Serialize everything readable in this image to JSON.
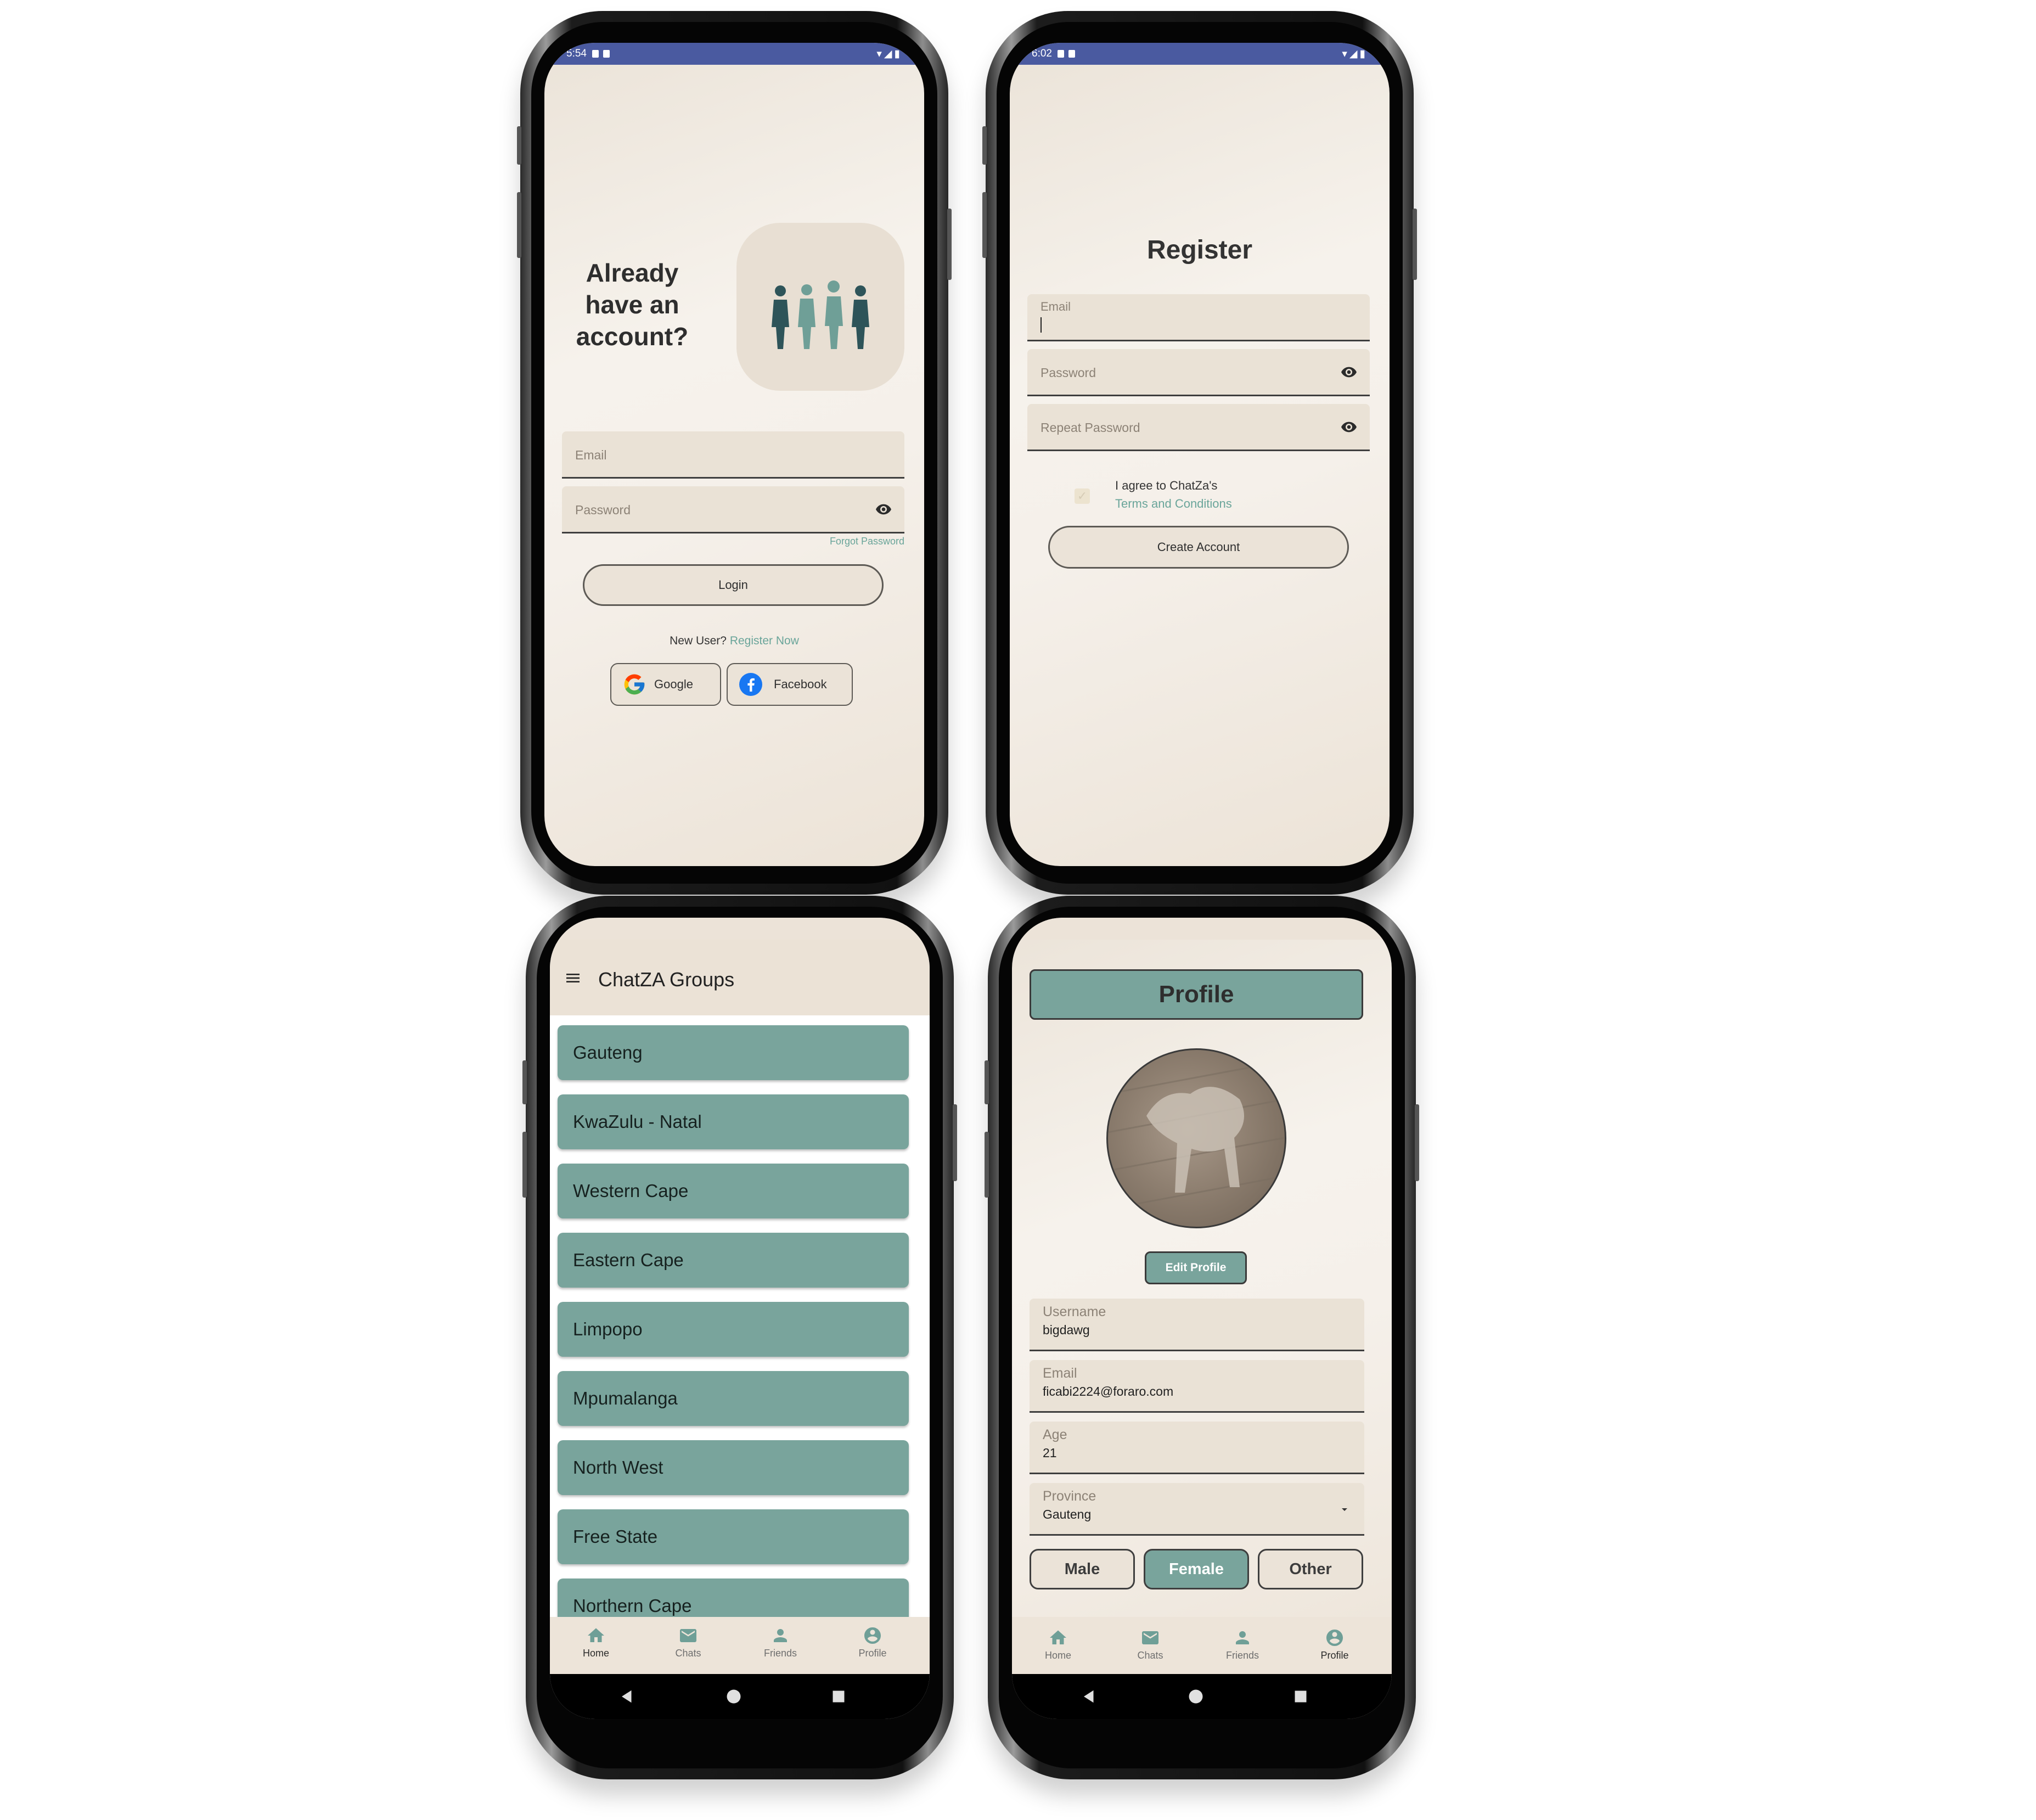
{
  "login": {
    "status_time": "5:54",
    "heading_line1": "Already",
    "heading_line2": "have an",
    "heading_line3": "account?",
    "email_label": "Email",
    "password_label": "Password",
    "forgot_password": "Forgot Password",
    "login_button": "Login",
    "new_user_text": "New User?",
    "register_link": "Register Now",
    "google_button": "Google",
    "facebook_button": "Facebook"
  },
  "register": {
    "status_time": "6:02",
    "title": "Register",
    "email_label": "Email",
    "password_label": "Password",
    "repeat_password_label": "Repeat Password",
    "agree_text": "I agree to ChatZa's",
    "terms_link": "Terms and Conditions",
    "create_button": "Create Account"
  },
  "groups": {
    "title": "ChatZA Groups",
    "items": [
      "Gauteng",
      "KwaZulu - Natal",
      "Western Cape",
      "Eastern Cape",
      "Limpopo",
      "Mpumalanga",
      "North West",
      "Free State",
      "Northern Cape"
    ]
  },
  "bottom_nav": {
    "items": [
      {
        "label": "Home",
        "icon": "home-icon"
      },
      {
        "label": "Chats",
        "icon": "mail-icon"
      },
      {
        "label": "Friends",
        "icon": "person-icon"
      },
      {
        "label": "Profile",
        "icon": "account-circle-icon"
      }
    ]
  },
  "profile": {
    "title": "Profile",
    "edit_button": "Edit Profile",
    "username_label": "Username",
    "username_value": "bigdawg",
    "email_label": "Email",
    "email_value": "ficabi2224@foraro.com",
    "age_label": "Age",
    "age_value": "21",
    "province_label": "Province",
    "province_value": "Gauteng",
    "gender_options": [
      "Male",
      "Female",
      "Other"
    ],
    "selected_gender": "Female"
  },
  "colors": {
    "accent_teal": "#79a49c",
    "field_beige": "#eae2d6",
    "statusbar_blue": "#4a5aa0"
  }
}
